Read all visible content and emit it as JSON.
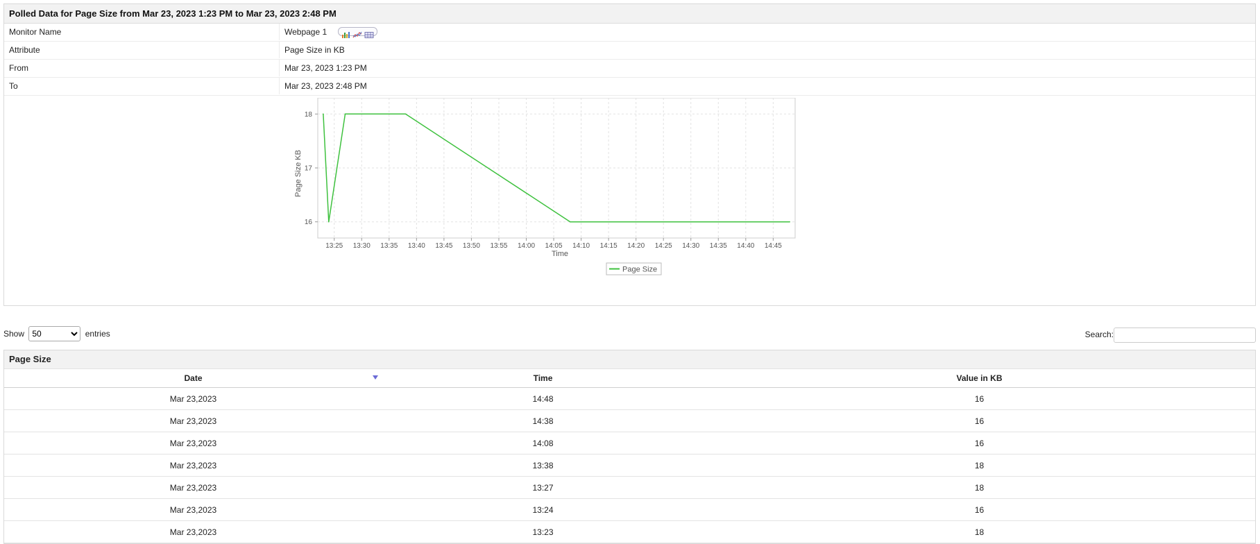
{
  "panel": {
    "title": "Polled Data for Page Size from Mar 23, 2023 1:23 PM to Mar 23, 2023 2:48 PM",
    "rows": [
      {
        "key": "Monitor Name",
        "value": "Webpage 1"
      },
      {
        "key": "Attribute",
        "value": "Page Size in KB"
      },
      {
        "key": "From",
        "value": "Mar 23, 2023 1:23 PM"
      },
      {
        "key": "To",
        "value": "Mar 23, 2023 2:48 PM"
      }
    ],
    "view_icons": [
      "bar-chart-icon",
      "line-chart-icon",
      "table-icon"
    ]
  },
  "chart_data": {
    "type": "line",
    "xlabel": "Time",
    "ylabel": "Page Size KB",
    "x_ticks": [
      "13:25",
      "13:30",
      "13:35",
      "13:40",
      "13:45",
      "13:50",
      "13:55",
      "14:00",
      "14:05",
      "14:10",
      "14:15",
      "14:20",
      "14:25",
      "14:30",
      "14:35",
      "14:40",
      "14:45"
    ],
    "y_ticks": [
      16,
      17,
      18
    ],
    "ylim": [
      15.7,
      18.3
    ],
    "xlim": [
      "13:22",
      "14:49"
    ],
    "grid": true,
    "legend_position": "bottom",
    "series": [
      {
        "name": "Page Size",
        "color": "#3ec13e",
        "points": [
          {
            "x": "13:23",
            "y": 18
          },
          {
            "x": "13:24",
            "y": 16
          },
          {
            "x": "13:27",
            "y": 18
          },
          {
            "x": "13:38",
            "y": 18
          },
          {
            "x": "14:08",
            "y": 16
          },
          {
            "x": "14:38",
            "y": 16
          },
          {
            "x": "14:48",
            "y": 16
          }
        ]
      }
    ]
  },
  "controls": {
    "show_label": "Show",
    "entries_value": "50",
    "entries_options": [
      "50"
    ],
    "entries_label": "entries",
    "search_label": "Search:",
    "search_placeholder": ""
  },
  "table": {
    "title": "Page Size",
    "columns": [
      "Date",
      "Time",
      "Value in KB"
    ],
    "rows": [
      [
        "Mar 23,2023",
        "14:48",
        "16"
      ],
      [
        "Mar 23,2023",
        "14:38",
        "16"
      ],
      [
        "Mar 23,2023",
        "14:08",
        "16"
      ],
      [
        "Mar 23,2023",
        "13:38",
        "18"
      ],
      [
        "Mar 23,2023",
        "13:27",
        "18"
      ],
      [
        "Mar 23,2023",
        "13:24",
        "16"
      ],
      [
        "Mar 23,2023",
        "13:23",
        "18"
      ]
    ]
  }
}
